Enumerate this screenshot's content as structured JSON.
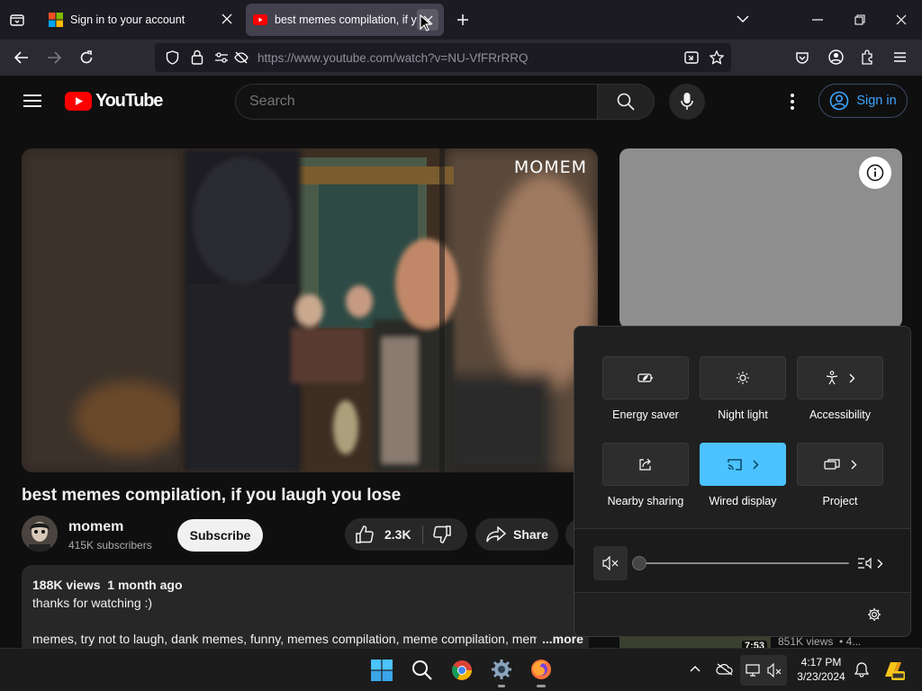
{
  "browser": {
    "tabs": [
      {
        "label": "Sign in to your account",
        "active": false
      },
      {
        "label": "best memes compilation, if you laugh you lose",
        "active": true
      }
    ],
    "url": "https://www.youtube.com/watch?v=NU-VfFRrRRQ"
  },
  "youtube": {
    "logo_text": "YouTube",
    "search_placeholder": "Search",
    "sign_in_label": "Sign in",
    "video_watermark": "MOMEM",
    "video_title": "best memes compilation, if you laugh you lose",
    "channel": {
      "name": "momem",
      "subscribers": "415K subscribers"
    },
    "subscribe_label": "Subscribe",
    "likes": "2.3K",
    "share_label": "Share",
    "description": {
      "views": "188K views",
      "age": "1 month ago",
      "line1": "thanks for watching :)",
      "tags": "memes, try not to laugh, dank memes, funny, memes compilation, meme compilation, mem",
      "more_label": "...more"
    },
    "sidebar_meta": {
      "duration": "7:53",
      "views": "851K views",
      "dot_text": "• 4..."
    }
  },
  "quick_settings": {
    "tiles": [
      {
        "label": "Energy saver",
        "icon": "energy-saver-icon",
        "active": false,
        "chevron": false
      },
      {
        "label": "Night light",
        "icon": "night-light-icon",
        "active": false,
        "chevron": false
      },
      {
        "label": "Accessibility",
        "icon": "accessibility-icon",
        "active": false,
        "chevron": true
      },
      {
        "label": "Nearby sharing",
        "icon": "share-icon",
        "active": false,
        "chevron": false
      },
      {
        "label": "Wired display",
        "icon": "cast-icon",
        "active": true,
        "chevron": true
      },
      {
        "label": "Project",
        "icon": "project-icon",
        "active": false,
        "chevron": true
      }
    ],
    "volume": 0,
    "accent_color": "#4cc2ff"
  },
  "taskbar": {
    "time": "4:17 PM",
    "date": "3/23/2024"
  },
  "colors": {
    "yt_red": "#ff0000",
    "link_blue": "#3ea6ff",
    "accent": "#4cc2ff"
  }
}
